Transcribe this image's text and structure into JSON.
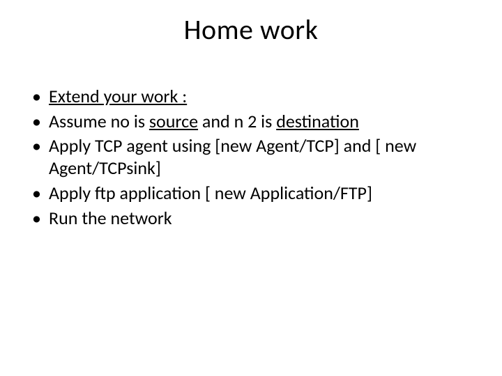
{
  "title": "Home work",
  "bullets": [
    {
      "segments": [
        {
          "text": "Extend your work :",
          "underline": true
        }
      ]
    },
    {
      "segments": [
        {
          "text": "Assume no is "
        },
        {
          "text": "source",
          "underline": true
        },
        {
          "text": " and n 2 is "
        },
        {
          "text": "destination",
          "underline": true
        }
      ]
    },
    {
      "segments": [
        {
          "text": "Apply TCP agent using [new Agent/TCP] and [ new Agent/TCPsink]"
        }
      ]
    },
    {
      "segments": [
        {
          "text": "Apply ftp application  [ new Application/FTP]"
        }
      ]
    },
    {
      "segments": [
        {
          "text": "Run the network"
        }
      ]
    }
  ]
}
